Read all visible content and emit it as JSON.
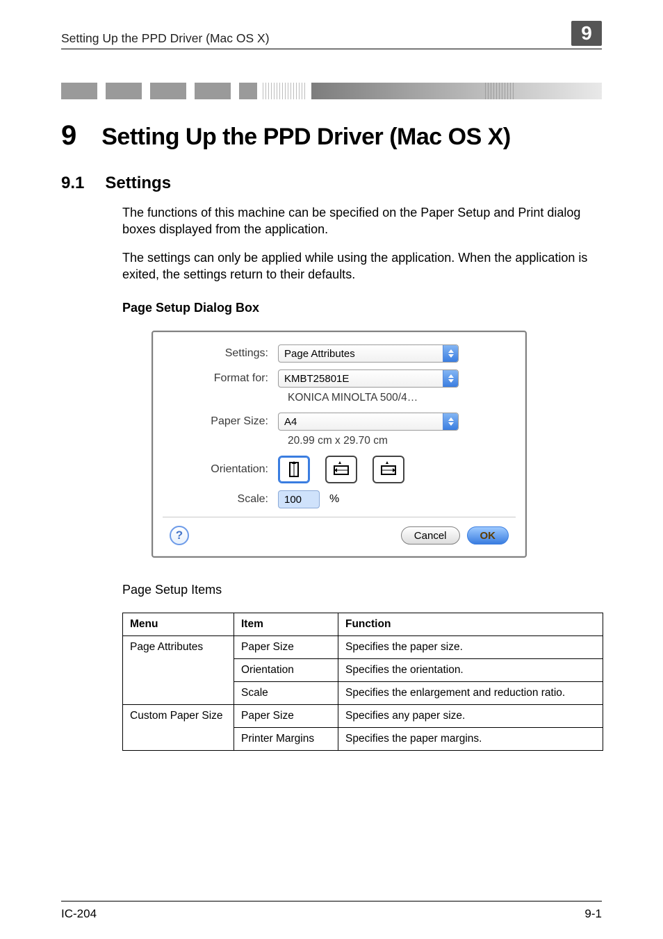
{
  "header": {
    "text": "Setting Up the PPD Driver (Mac OS X)",
    "chapnum": "9"
  },
  "chapter": {
    "num": "9",
    "title": "Setting Up the PPD Driver (Mac OS X)"
  },
  "section": {
    "num": "9.1",
    "title": "Settings"
  },
  "body": {
    "p1": "The functions of this machine can be specified on the Paper Setup and Print dialog boxes displayed from the application.",
    "p2": "The settings can only be applied while using the application. When the application is exited, the settings return to their defaults."
  },
  "subhead": "Page Setup Dialog Box",
  "dialog": {
    "labels": {
      "settings": "Settings:",
      "format_for": "Format for:",
      "paper_size": "Paper Size:",
      "orientation": "Orientation:",
      "scale": "Scale:"
    },
    "values": {
      "settings": "Page Attributes",
      "format_for": "KMBT25801E",
      "format_for_desc": "KONICA MINOLTA 500/4…",
      "paper_size": "A4",
      "paper_dims": "20.99 cm x 29.70 cm",
      "scale": "100",
      "scale_unit": "%"
    },
    "buttons": {
      "help": "?",
      "cancel": "Cancel",
      "ok": "OK"
    }
  },
  "subhead2": "Page Setup Items",
  "table": {
    "headers": {
      "menu": "Menu",
      "item": "Item",
      "func": "Function"
    },
    "rows": [
      {
        "menu": "Page Attributes",
        "item": "Paper Size",
        "func": "Specifies the paper size."
      },
      {
        "menu": "",
        "item": "Orientation",
        "func": "Specifies the orientation."
      },
      {
        "menu": "",
        "item": "Scale",
        "func": "Specifies the enlargement and reduction ratio."
      },
      {
        "menu": "Custom Paper Size",
        "item": "Paper Size",
        "func": "Specifies any paper size."
      },
      {
        "menu": "",
        "item": "Printer Margins",
        "func": "Specifies the paper margins."
      }
    ]
  },
  "footer": {
    "left": "IC-204",
    "right": "9-1"
  }
}
